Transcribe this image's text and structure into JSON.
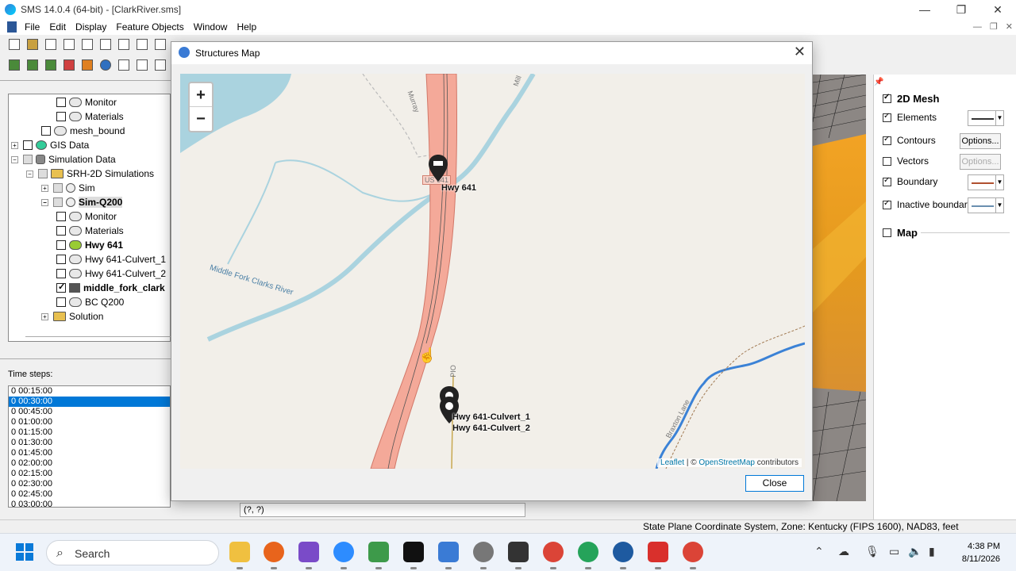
{
  "window": {
    "title": "SMS 14.0.4 (64-bit) - [ClarkRiver.sms]",
    "controls": [
      "—",
      "❐",
      "✕"
    ]
  },
  "menu": [
    "File",
    "Edit",
    "Display",
    "Feature Objects",
    "Window",
    "Help"
  ],
  "tree": [
    {
      "label": "Monitor",
      "indent": 4,
      "check": "off",
      "icon": "generic"
    },
    {
      "label": "Materials",
      "indent": 4,
      "check": "off",
      "icon": "generic"
    },
    {
      "label": "mesh_bound",
      "indent": 3,
      "check": "off",
      "icon": "generic"
    },
    {
      "label": "GIS Data",
      "indent": 1,
      "check": "off",
      "icon": "globe",
      "expander": "+"
    },
    {
      "label": "Simulation Data",
      "indent": 1,
      "check": "grey",
      "icon": "db",
      "expander": "−"
    },
    {
      "label": "SRH-2D Simulations",
      "indent": 2,
      "check": "grey",
      "icon": "folder",
      "expander": "−"
    },
    {
      "label": "Sim",
      "indent": 3,
      "check": "grey",
      "icon": "sim",
      "expander": "+"
    },
    {
      "label": "Sim-Q200",
      "indent": 3,
      "check": "grey",
      "icon": "sim",
      "expander": "−",
      "bold": true,
      "selected": true
    },
    {
      "label": "Monitor",
      "indent": 4,
      "check": "off",
      "icon": "generic"
    },
    {
      "label": "Materials",
      "indent": 4,
      "check": "off",
      "icon": "generic"
    },
    {
      "label": "Hwy 641",
      "indent": 4,
      "check": "off",
      "icon": "green",
      "bold": true
    },
    {
      "label": "Hwy 641-Culvert_1",
      "indent": 4,
      "check": "off",
      "icon": "generic"
    },
    {
      "label": "Hwy 641-Culvert_2",
      "indent": 4,
      "check": "off",
      "icon": "generic"
    },
    {
      "label": "middle_fork_clark",
      "indent": 4,
      "check": "on",
      "icon": "mesh",
      "bold": true
    },
    {
      "label": "BC Q200",
      "indent": 4,
      "check": "off",
      "icon": "generic"
    },
    {
      "label": "Solution",
      "indent": 3,
      "check": "none",
      "icon": "folder",
      "expander": "+"
    }
  ],
  "timesteps": {
    "label": "Time steps:",
    "items": [
      "0 00:15:00",
      "0 00:30:00",
      "0 00:45:00",
      "0 01:00:00",
      "0 01:15:00",
      "0 01:30:00",
      "0 01:45:00",
      "0 02:00:00",
      "0 02:15:00",
      "0 02:30:00",
      "0 02:45:00",
      "0 03:00:00"
    ],
    "selected_index": 1
  },
  "display_options": {
    "rows": [
      {
        "label": "2D Mesh",
        "checked": true,
        "header": true
      },
      {
        "label": "Elements",
        "checked": true,
        "control": "line",
        "color": "#333333"
      },
      {
        "label": "Contours",
        "checked": true,
        "control": "options",
        "button": "Options..."
      },
      {
        "label": "Vectors",
        "checked": false,
        "control": "options-disabled",
        "button": "Options..."
      },
      {
        "label": "Boundary",
        "checked": true,
        "control": "line",
        "color": "#b05030"
      },
      {
        "label": "Inactive boundary",
        "checked": true,
        "control": "line",
        "color": "#6a8fb0"
      },
      {
        "label": "Map",
        "checked": false,
        "header": true
      }
    ]
  },
  "dialog": {
    "title": "Structures Map",
    "close_x": "✕",
    "close_button": "Close",
    "zoom_in": "+",
    "zoom_out": "−",
    "markers": [
      {
        "label": "Hwy 641"
      },
      {
        "label": "Hwy 641-Culvert_1"
      },
      {
        "label": "Hwy 641-Culvert_2"
      }
    ],
    "river_label": "Middle Fork Clarks River",
    "road_labels": [
      "Murray",
      "US 641",
      "Braxton Lane",
      "PIO",
      "Mill"
    ],
    "attribution": {
      "leaflet": "Leaflet",
      "sep": " | © ",
      "osm": "OpenStreetMap",
      "suffix": " contributors"
    }
  },
  "status": {
    "coords": "(?, ?)",
    "coord_system": "State Plane Coordinate System, Zone: Kentucky (FIPS 1600), NAD83, feet"
  },
  "taskbar": {
    "search": "Search",
    "time": "4:38 PM",
    "date": "8/11/2026"
  },
  "colors": {
    "selection": "#0078d7",
    "highway": "#f4a999",
    "water": "#aad3df",
    "stream": "#3b82d6"
  }
}
